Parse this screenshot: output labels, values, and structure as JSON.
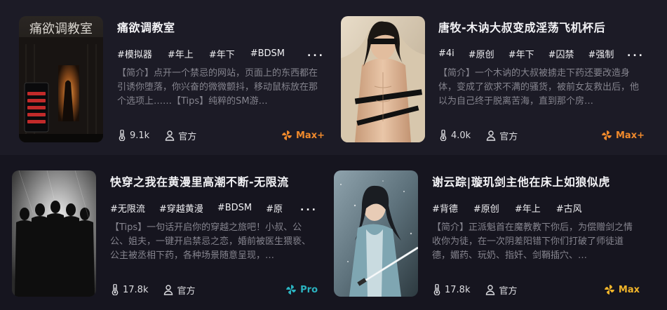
{
  "colors": {
    "max_plus": "#f08a2c",
    "pro": "#2bb3c0",
    "max": "#f2b52a",
    "desc": "#85848e"
  },
  "cards": [
    {
      "title": "痛欲调教室",
      "cover_text": "痛欲调教室",
      "tags": [
        "#模拟器",
        "#年上",
        "#年下",
        "#BDSM"
      ],
      "more": "...",
      "description": "【简介】点开一个禁忌的网站，页面上的东西都在引诱你堕落，你兴奋的微微颤抖，移动鼠标放在那个选项上……【Tips】纯粹的SM游…",
      "heat_icon": "thermometer-icon",
      "heat": "9.1k",
      "source_icon": "user-icon",
      "source": "官方",
      "tier_icon": "pinwheel-icon",
      "tier": "Max+"
    },
    {
      "title": "唐牧-木讷大叔变成淫荡飞机杯后",
      "tags": [
        "#4i",
        "#原创",
        "#年下",
        "#囚禁",
        "#强制"
      ],
      "more": "...",
      "description": "【简介】一个木讷的大叔被掳走下药还要改造身体，变成了欲求不满的骚货，被前女友救出后，他以为自己终于脱离苦海，直到那个房…",
      "heat_icon": "thermometer-icon",
      "heat": "4.0k",
      "source_icon": "user-icon",
      "source": "官方",
      "tier_icon": "pinwheel-icon",
      "tier": "Max+"
    },
    {
      "title": "快穿之我在黄漫里高潮不断-无限流",
      "tags": [
        "#无限流",
        "#穿越黄漫",
        "#BDSM",
        "#原"
      ],
      "more": "...",
      "description": "【Tips】一句话开启你的穿越之旅吧！小叔、公公、姐夫，一键开启禁忌之恋，婚前被医生猥亵、公主被丞相下药，各种场景随意呈现，…",
      "heat_icon": "thermometer-icon",
      "heat": "17.8k",
      "source_icon": "user-icon",
      "source": "官方",
      "tier_icon": "pinwheel-icon",
      "tier": "Pro"
    },
    {
      "title": "谢云踪|璇玑剑主他在床上如狼似虎",
      "tags": [
        "#背德",
        "#原创",
        "#年上",
        "#古风"
      ],
      "more": "",
      "description": "【简介】正派魁首在魔教教下你后，为偿赠剑之情收你为徒，在一次阴差阳错下你们打破了师徒道德，媚药、玩奶、指奸、剑鞘插穴、…",
      "heat_icon": "thermometer-icon",
      "heat": "17.8k",
      "source_icon": "user-icon",
      "source": "官方",
      "tier_icon": "pinwheel-icon",
      "tier": "Max"
    }
  ]
}
